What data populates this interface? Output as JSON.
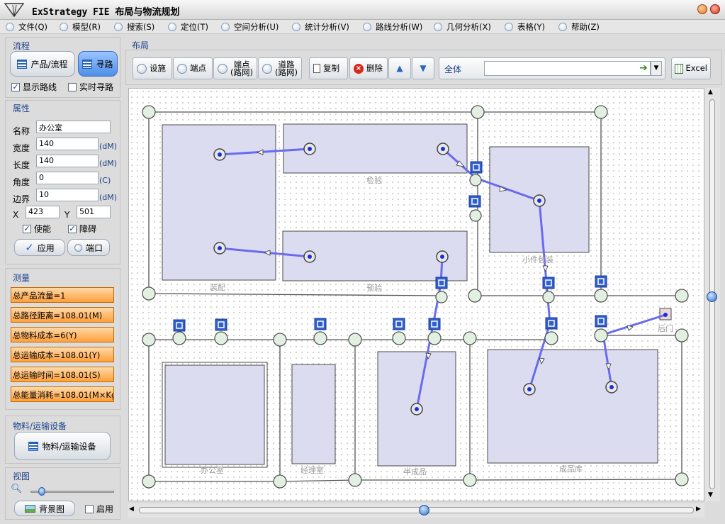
{
  "app": {
    "title": "ExStrategy FIE 布局与物流规划"
  },
  "menu": [
    "文件(Q)",
    "模型(R)",
    "搜索(S)",
    "定位(T)",
    "空间分析(U)",
    "统计分析(V)",
    "路线分析(W)",
    "几何分析(X)",
    "表格(Y)",
    "帮助(Z)"
  ],
  "flow": {
    "section": "流程",
    "product_button": "产品/流程",
    "route_button": "寻路",
    "show_route": "显示路线",
    "realtime_route": "实时寻路"
  },
  "props": {
    "section": "属性",
    "name_label": "名称",
    "name_value": "办公室",
    "width_label": "宽度",
    "width_value": "140",
    "width_unit": "(dM)",
    "length_label": "长度",
    "length_value": "140",
    "length_unit": "(dM)",
    "angle_label": "角度",
    "angle_value": "0",
    "angle_unit": "(C)",
    "border_label": "边界",
    "border_value": "10",
    "border_unit": "(dM)",
    "x_label": "X",
    "x_value": "423",
    "y_label": "Y",
    "y_value": "501",
    "enable_label": "使能",
    "obstacle_label": "障碍",
    "apply_button": "应用",
    "port_button": "端口"
  },
  "measure": {
    "section": "测量",
    "items": [
      "总产品流量=1",
      "总路径距离=108.01(M)",
      "总物料成本=6(Y)",
      "总运输成本=108.01(Y)",
      "总运输时间=108.01(S)",
      "总能量消耗=108.01(M×Kg"
    ]
  },
  "material": {
    "section": "物料/运输设备",
    "button": "物料/运输设备"
  },
  "view": {
    "section": "视图",
    "bg_button": "背景图",
    "enable_label": "启用"
  },
  "layout": {
    "section": "布局",
    "tools": {
      "facility": "设施",
      "endpoint": "端点",
      "endpoint_net_1": "端点",
      "endpoint_net_2": "(路网)",
      "road_net_1": "道路",
      "road_net_2": "(路网)",
      "copy": "复制",
      "delete": "删除",
      "filter_label": "全体",
      "excel": "Excel"
    },
    "facility_labels": {
      "assembly": "装配",
      "inspection": "检验",
      "prefab": "预验",
      "small_pack": "小件包装",
      "office": "办公室",
      "manager": "经理室",
      "semi": "半成品",
      "finished": "成品库",
      "back_door": "后门"
    }
  }
}
